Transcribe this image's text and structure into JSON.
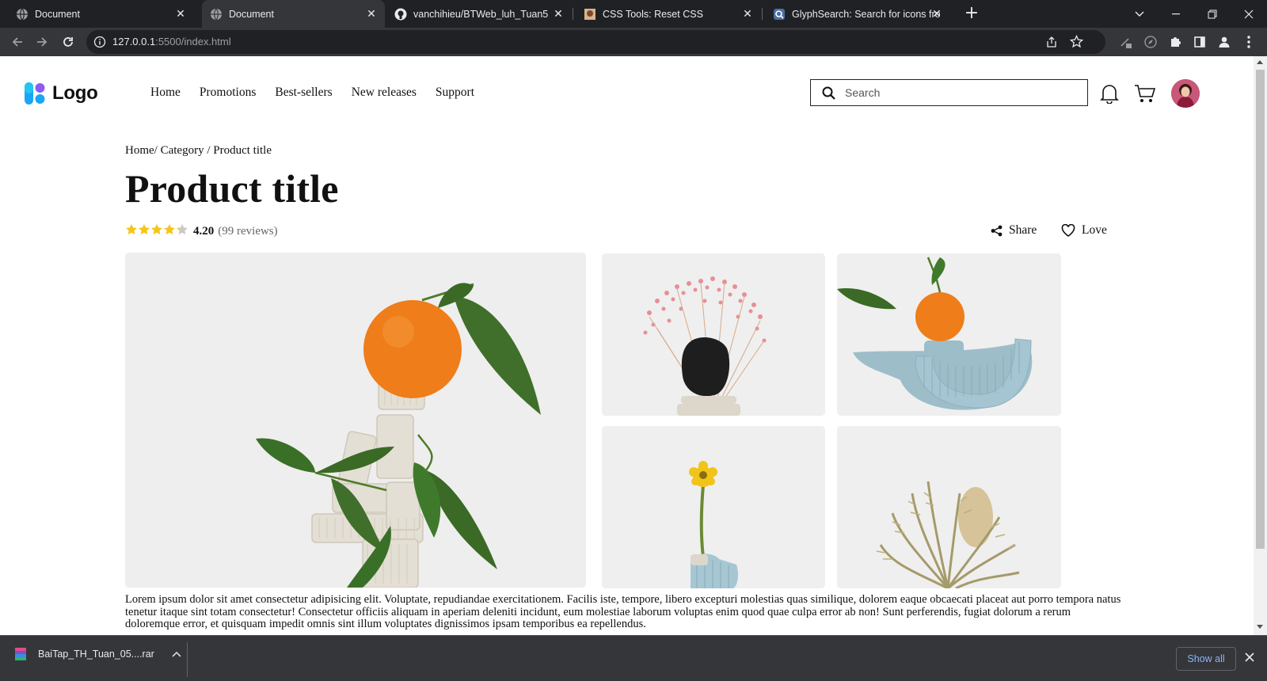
{
  "browser": {
    "tabs": [
      {
        "title": "Document",
        "icon": "globe-icon"
      },
      {
        "title": "Document",
        "icon": "globe-icon"
      },
      {
        "title": "vanchihieu/BTWeb_luh_Tuan5",
        "icon": "github-icon"
      },
      {
        "title": "CSS Tools: Reset CSS",
        "icon": "site-favicon-icon"
      },
      {
        "title": "GlyphSearch: Search for icons fro",
        "icon": "glyphsearch-icon"
      }
    ],
    "address": {
      "host": "127.0.0.1",
      "rest": ":5500/index.html"
    }
  },
  "site": {
    "logo_text": "Logo",
    "nav": [
      "Home",
      "Promotions",
      "Best-sellers",
      "New releases",
      "Support"
    ],
    "search_placeholder": "Search"
  },
  "product": {
    "breadcrumb": {
      "home": "Home",
      "sep1": "/",
      "category": "Category",
      "sep2": "/",
      "current": "Product title"
    },
    "title": "Product title",
    "rating_value": 4.2,
    "rating_text": "4.20",
    "reviews_text": "(99 reviews)",
    "share_label": "Share",
    "love_label": "Love",
    "gallery": [
      "Tangerine on clay sculpture",
      "Pink flowers with black rock",
      "Tangerine on blue clay arch",
      "Yellow flower in blue vase",
      "Dried banksia flowers"
    ],
    "description": "Lorem ipsum dolor sit amet consectetur adipisicing elit. Voluptate, repudiandae exercitationem. Facilis iste, tempore, libero excepturi molestias quas similique, dolorem eaque obcaecati placeat aut porro tempora natus tenetur itaque sint totam consectetur! Consectetur officiis aliquam in aperiam deleniti incidunt, eum molestiae laborum voluptas enim quod quae culpa error ab non! Sunt perferendis, fugiat dolorum a rerum doloremque error, et quisquam impedit omnis sint illum voluptates dignissimos ipsam temporibus ea repellendus."
  },
  "downloads": {
    "file": "BaiTap_TH_Tuan_05....rar",
    "show_all": "Show all"
  },
  "colors": {
    "star": "#f5c518",
    "chrome_dark": "#202124",
    "chrome_mid": "#35363a",
    "link_blue": "#8ab4f8"
  }
}
